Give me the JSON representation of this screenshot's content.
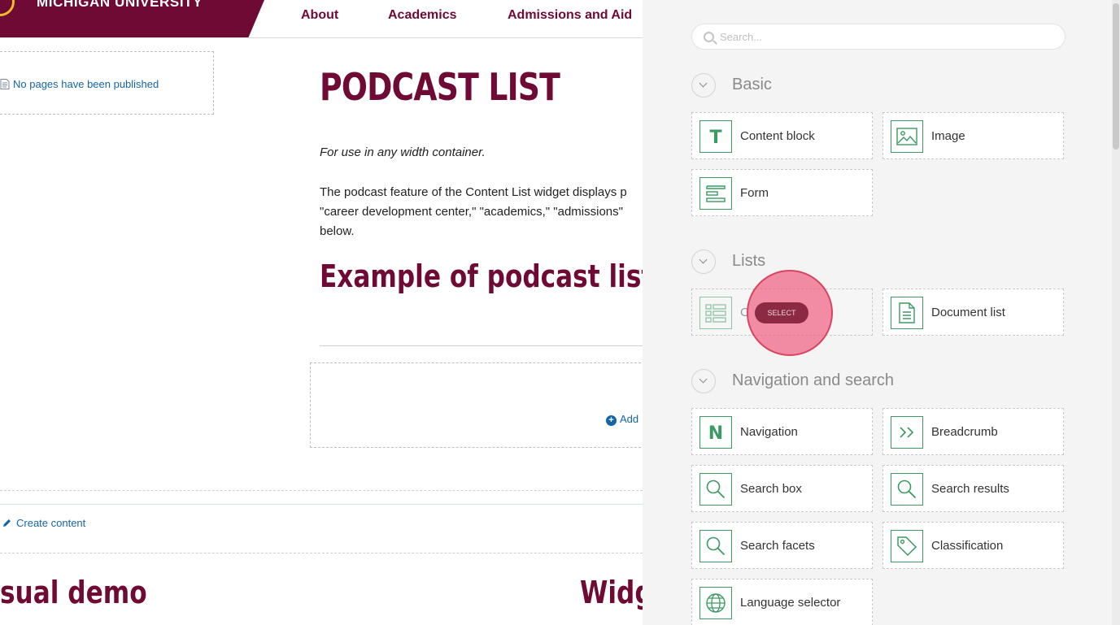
{
  "site": {
    "name": "MICHIGAN UNIVERSITY",
    "nav": [
      "About",
      "Academics",
      "Admissions and Aid"
    ]
  },
  "page": {
    "sidebar_link": "No pages have been published",
    "title": "PODCAST LIST",
    "intro": "For use in any width container.",
    "desc_lines": [
      "The podcast feature of the Content List widget displays p",
      "\"career development center,\" \"academics,\" \"admissions\"",
      "below."
    ],
    "example_heading": "Example of podcast list",
    "add_link": "Add",
    "create_link": "Create content",
    "bottom_left_heading": "sual demo",
    "bottom_right_heading": "Widg"
  },
  "panel": {
    "search_placeholder": "Search...",
    "sections": [
      {
        "label": "Basic",
        "widgets": [
          {
            "label": "Content block",
            "icon": "text-T-icon"
          },
          {
            "label": "Image",
            "icon": "image-icon"
          },
          {
            "label": "Form",
            "icon": "form-icon"
          }
        ]
      },
      {
        "label": "Lists",
        "widgets": [
          {
            "label": "C",
            "icon": "content-list-icon"
          },
          {
            "label": "Document list",
            "icon": "document-list-icon"
          }
        ]
      },
      {
        "label": "Navigation and search",
        "widgets": [
          {
            "label": "Navigation",
            "icon": "navigation-N-icon"
          },
          {
            "label": "Breadcrumb",
            "icon": "breadcrumb-icon"
          },
          {
            "label": "Search box",
            "icon": "search-icon"
          },
          {
            "label": "Search results",
            "icon": "search-icon"
          },
          {
            "label": "Search facets",
            "icon": "search-icon"
          },
          {
            "label": "Classification",
            "icon": "tag-icon"
          },
          {
            "label": "Language selector",
            "icon": "globe-icon"
          }
        ]
      }
    ],
    "select_label": "SELECT"
  },
  "colors": {
    "brand": "#6e0a34",
    "accent_green": "#3a9a62",
    "link": "#1565a6",
    "cursor": "#f06284"
  }
}
